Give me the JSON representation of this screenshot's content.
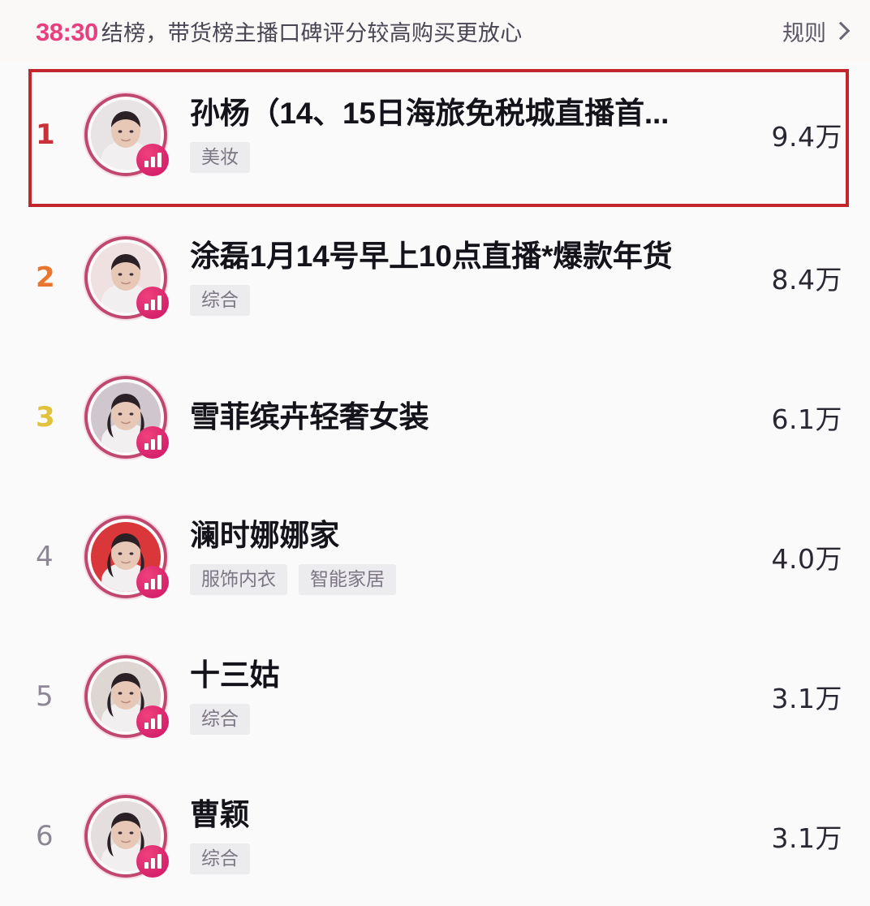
{
  "header": {
    "timer": "38:30",
    "note": "结榜，带货榜主播口碑评分较高购买更放心",
    "rules_label": "规则",
    "chevron_icon": "chevron-right-icon",
    "timer_color": "#e8407f"
  },
  "colors": {
    "rank_1": "#c8313a",
    "rank_2": "#e8762f",
    "rank_3": "#e2c13c",
    "rank_dim": "#8d8795",
    "highlight_border": "#c0262b",
    "avatar_ring": "#c0486e",
    "live_badge": "#e0246e",
    "background": "#fbfafb"
  },
  "highlight": {
    "target_rank": "1",
    "note": "red annotation box around rank 1 row"
  },
  "list": {
    "rows": [
      {
        "rank": "1",
        "title": "孙杨（14、15日海旅免税城直播首...",
        "tags": [
          "美妆"
        ],
        "value": "9.4万",
        "badge_icon": "live-bars-icon",
        "avatar_icon": "avatar-male-photo",
        "highlighted": true
      },
      {
        "rank": "2",
        "title": "涂磊1月14号早上10点直播*爆款年货",
        "tags": [
          "综合"
        ],
        "value": "8.4万",
        "badge_icon": "live-bars-icon",
        "avatar_icon": "avatar-male-photo",
        "highlighted": false
      },
      {
        "rank": "3",
        "title": "雪菲缤卉轻奢女装",
        "tags": [],
        "value": "6.1万",
        "badge_icon": "live-bars-icon",
        "avatar_icon": "avatar-female-photo",
        "highlighted": false
      },
      {
        "rank": "4",
        "title": "澜时娜娜家",
        "tags": [
          "服饰内衣",
          "智能家居"
        ],
        "value": "4.0万",
        "badge_icon": "live-bars-icon",
        "avatar_icon": "avatar-female-photo",
        "highlighted": false
      },
      {
        "rank": "5",
        "title": "十三姑",
        "tags": [
          "综合"
        ],
        "value": "3.1万",
        "badge_icon": "live-bars-icon",
        "avatar_icon": "avatar-female-photo",
        "highlighted": false
      },
      {
        "rank": "6",
        "title": "曹颖",
        "tags": [
          "综合"
        ],
        "value": "3.1万",
        "badge_icon": "live-bars-icon",
        "avatar_icon": "avatar-female-photo",
        "highlighted": false
      }
    ]
  }
}
